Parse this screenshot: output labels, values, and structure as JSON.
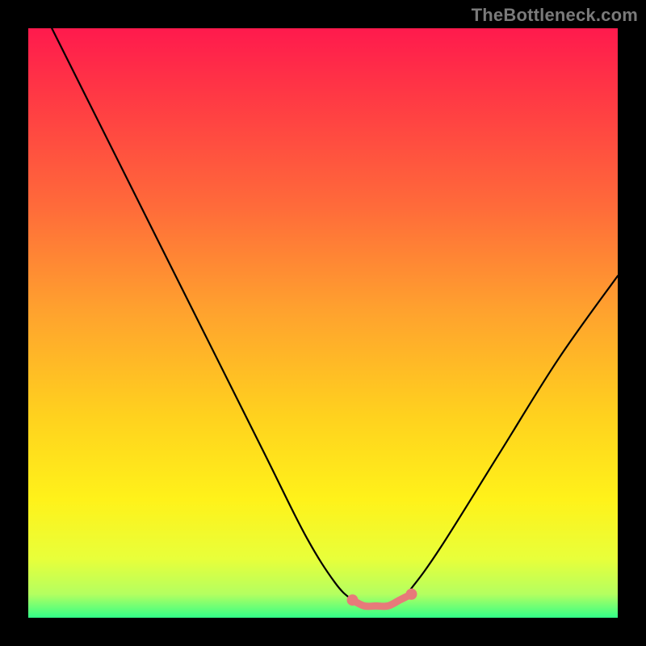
{
  "watermark": "TheBottleneck.com",
  "chart_data": {
    "type": "line",
    "title": "",
    "xlabel": "",
    "ylabel": "",
    "xlim": [
      0,
      100
    ],
    "ylim": [
      0,
      100
    ],
    "grid": false,
    "legend": false,
    "series": [
      {
        "name": "bottleneck-curve",
        "color": "#000000",
        "x": [
          4,
          10,
          20,
          30,
          40,
          47,
          52,
          55,
          57,
          59,
          61,
          63,
          65,
          70,
          80,
          90,
          100
        ],
        "y": [
          100,
          88,
          68,
          48,
          28,
          14,
          6,
          3,
          2,
          2,
          2,
          3,
          5,
          12,
          28,
          44,
          58
        ]
      },
      {
        "name": "optimal-range",
        "color": "#e77a7a",
        "x": [
          55,
          57,
          59,
          61,
          63,
          65
        ],
        "y": [
          3,
          2,
          2,
          2,
          3,
          4
        ]
      }
    ],
    "markers": {
      "name": "optimal-endpoints",
      "color": "#e77a7a",
      "points": [
        {
          "x": 55,
          "y": 3
        },
        {
          "x": 65,
          "y": 4
        }
      ]
    }
  }
}
